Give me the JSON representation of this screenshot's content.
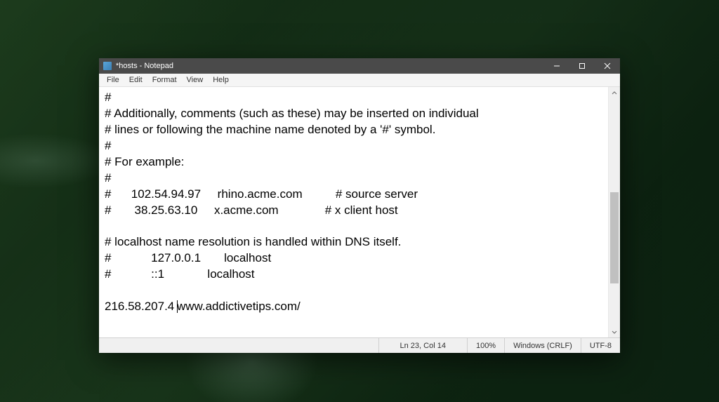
{
  "window": {
    "title": "*hosts - Notepad"
  },
  "menu": {
    "items": [
      "File",
      "Edit",
      "Format",
      "View",
      "Help"
    ]
  },
  "content": {
    "line1": "#",
    "line2": "# Additionally, comments (such as these) may be inserted on individual",
    "line3": "# lines or following the machine name denoted by a '#' symbol.",
    "line4": "#",
    "line5": "# For example:",
    "line6": "#",
    "line7": "#      102.54.94.97     rhino.acme.com          # source server",
    "line8": "#       38.25.63.10     x.acme.com              # x client host",
    "line9": "",
    "line10": "# localhost name resolution is handled within DNS itself.",
    "line11": "#            127.0.0.1       localhost",
    "line12": "#            ::1             localhost",
    "line13": "",
    "line14a": "216.58.207.4 ",
    "line14b": "www.addictivetips.com/"
  },
  "status": {
    "position": "Ln 23, Col 14",
    "zoom": "100%",
    "lineending": "Windows (CRLF)",
    "encoding": "UTF-8"
  }
}
